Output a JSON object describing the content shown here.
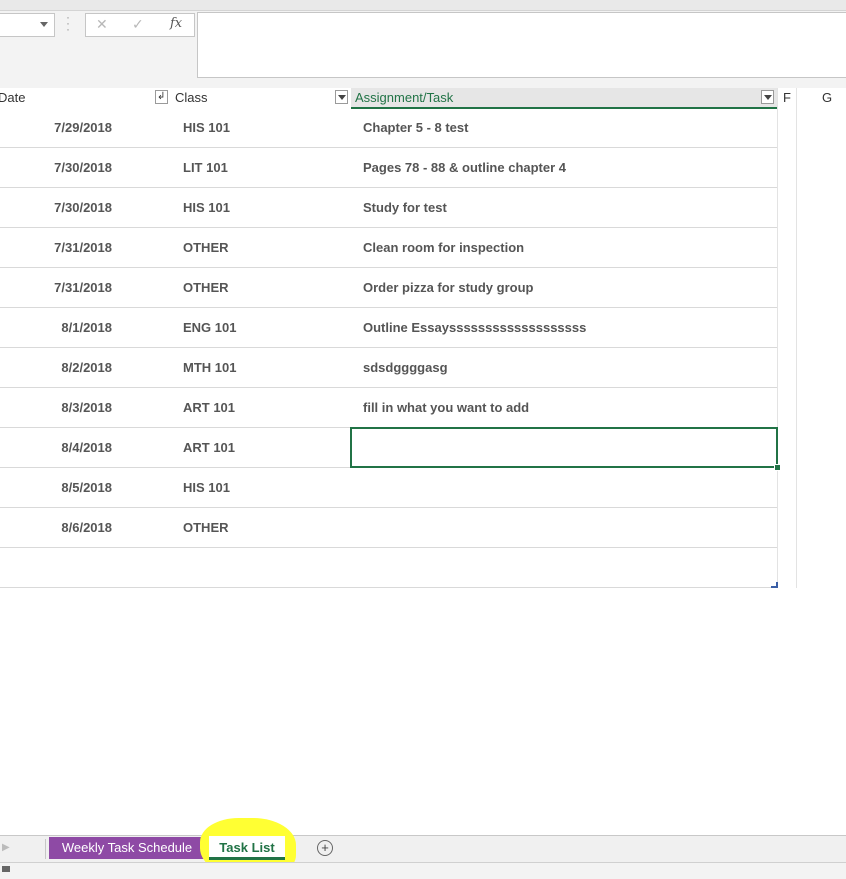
{
  "formula_bar": {
    "cancel_icon": "✕",
    "enter_icon": "✓",
    "fx_label": "fx",
    "content": ""
  },
  "columns": {
    "date": "Date",
    "class": "Class",
    "task": "Assignment/Task",
    "f": "F",
    "g": "G"
  },
  "rows": [
    {
      "date": "7/29/2018",
      "class": "HIS 101",
      "task": "Chapter 5 - 8 test"
    },
    {
      "date": "7/30/2018",
      "class": "LIT 101",
      "task": "Pages 78 - 88 & outline chapter 4"
    },
    {
      "date": "7/30/2018",
      "class": "HIS 101",
      "task": "Study for test"
    },
    {
      "date": "7/31/2018",
      "class": "OTHER",
      "task": "Clean room for inspection"
    },
    {
      "date": "7/31/2018",
      "class": "OTHER",
      "task": "Order pizza for study group"
    },
    {
      "date": "8/1/2018",
      "class": "ENG 101",
      "task": "Outline Essaysssssssssssssssssss"
    },
    {
      "date": "8/2/2018",
      "class": "MTH 101",
      "task": "sdsdggggasg"
    },
    {
      "date": "8/3/2018",
      "class": "ART 101",
      "task": "fill in what you want to add"
    },
    {
      "date": "8/4/2018",
      "class": "ART 101",
      "task": ""
    },
    {
      "date": "8/5/2018",
      "class": "HIS 101",
      "task": ""
    },
    {
      "date": "8/6/2018",
      "class": "OTHER",
      "task": ""
    }
  ],
  "sheet_tabs": {
    "tab1": "Weekly Task Schedule",
    "tab2": "Task List",
    "add": "+"
  },
  "colors": {
    "excel_green": "#217346",
    "tab_purple": "#8e4aa5",
    "highlight_yellow": "#ffff33"
  }
}
